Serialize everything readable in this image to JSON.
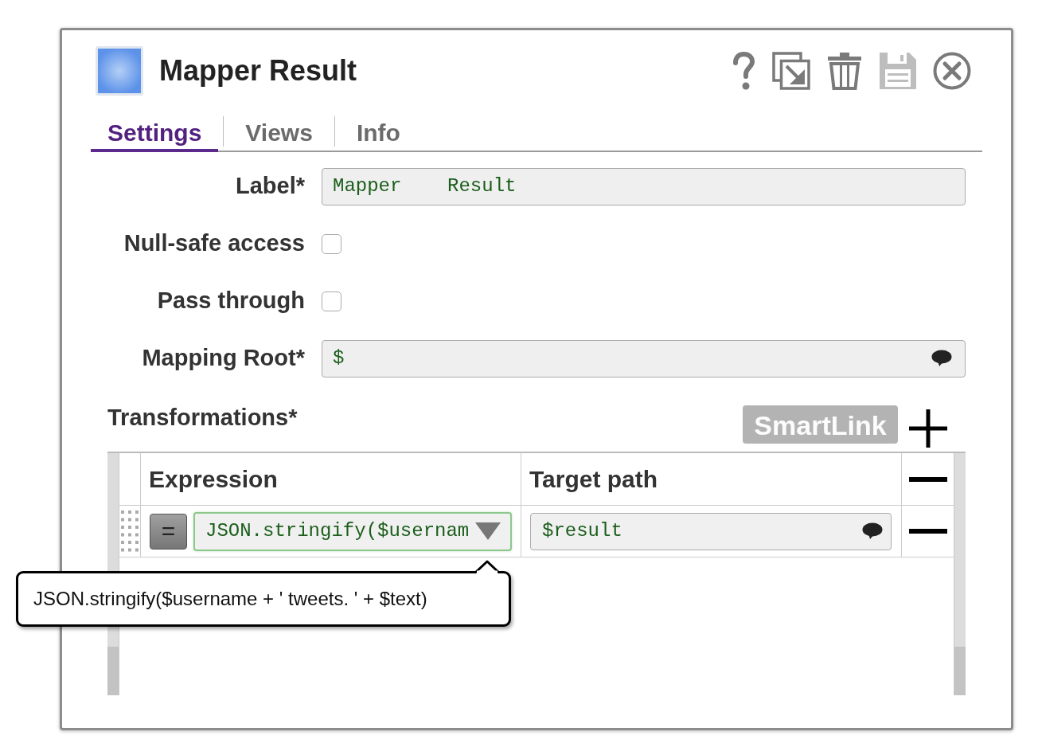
{
  "window": {
    "title": "Mapper Result"
  },
  "toolbar": [
    {
      "kind": "help",
      "disabled": false
    },
    {
      "kind": "export",
      "disabled": false
    },
    {
      "kind": "delete",
      "disabled": false
    },
    {
      "kind": "save",
      "disabled": true
    },
    {
      "kind": "close",
      "disabled": false
    }
  ],
  "tabs": [
    {
      "label": "Settings",
      "selected": true
    },
    {
      "label": "Views",
      "selected": false
    },
    {
      "label": "Info",
      "selected": false
    }
  ],
  "fields": [
    {
      "kind": "text",
      "label": "Label*",
      "value": "Mapper    Result"
    },
    {
      "kind": "checkbox",
      "label": "Null-safe access",
      "checked": false
    },
    {
      "kind": "checkbox",
      "label": "Pass through",
      "checked": false
    },
    {
      "kind": "expression",
      "label": "Mapping Root*",
      "value": "$"
    }
  ],
  "transformations": {
    "label": "Transformations*",
    "smartlink": {
      "label": "SmartLink",
      "disabled": true
    },
    "columns": [
      "Expression",
      "Target path"
    ],
    "rows": [
      {
        "mode": "=",
        "expression": "JSON.stringify($usernam",
        "focused": true,
        "target_path": "$result"
      }
    ]
  },
  "tooltip": {
    "text": "JSON.stringify($username + ' tweets. ' + $text)"
  }
}
